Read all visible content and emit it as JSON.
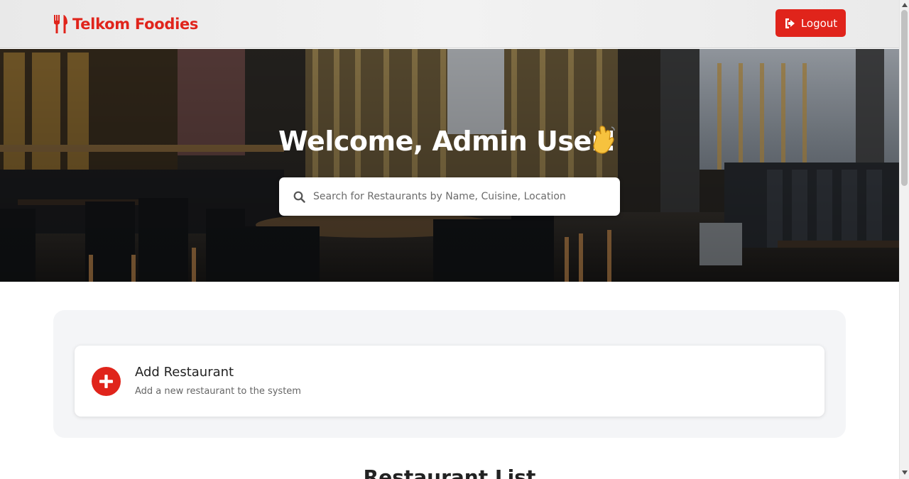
{
  "navbar": {
    "brand_text": "Telkom Foodies",
    "brand_icon": "utensils-icon",
    "logout_label": "Logout",
    "logout_icon": "sign-out-icon"
  },
  "hero": {
    "welcome_text": "Welcome, Admin User!",
    "wave_icon": "waving-hand-icon",
    "search": {
      "placeholder": "Search for Restaurants by Name, Cuisine, Location",
      "value": ""
    }
  },
  "admin_panel": {
    "add_card": {
      "title": "Add Restaurant",
      "description": "Add a new restaurant to the system",
      "icon": "plus-circle-icon"
    }
  },
  "section_heading": "Restaurant List",
  "colors": {
    "brand": "#e0241b",
    "panel_bg": "#f4f5f7",
    "card_bg": "#ffffff"
  }
}
